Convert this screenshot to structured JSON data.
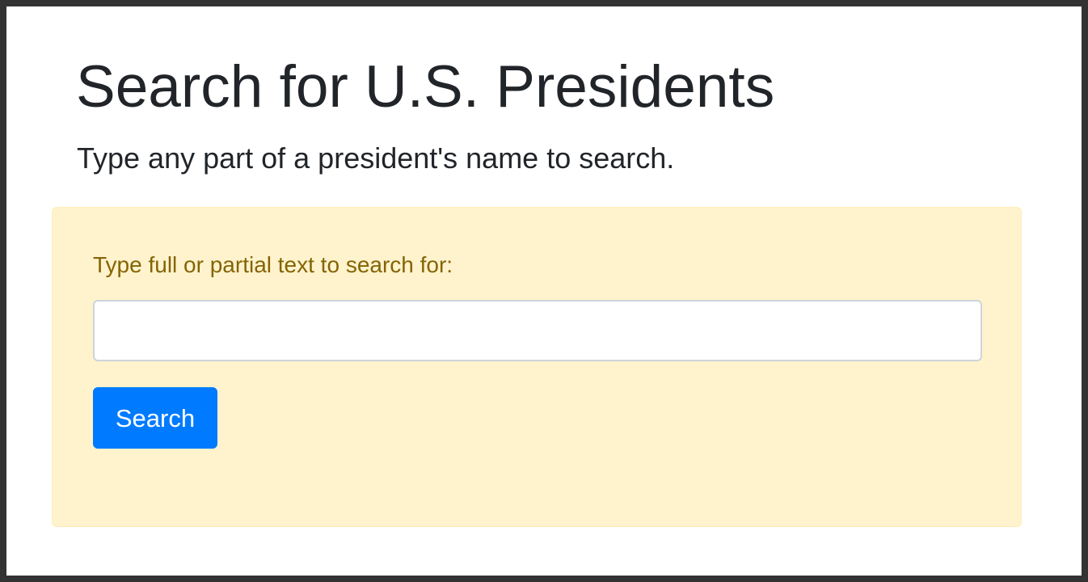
{
  "page": {
    "title": "Search for U.S. Presidents",
    "subtitle": "Type any part of a president's name to search."
  },
  "search_form": {
    "label": "Type full or partial text to search for:",
    "input_value": "",
    "button_label": "Search"
  },
  "colors": {
    "frame_border": "#333333",
    "background": "#ffffff",
    "text": "#212529",
    "panel_background": "#fff3cd",
    "panel_border": "#ffeeba",
    "panel_text": "#856404",
    "input_border": "#ced4da",
    "button_primary": "#007bff",
    "button_text": "#ffffff"
  }
}
